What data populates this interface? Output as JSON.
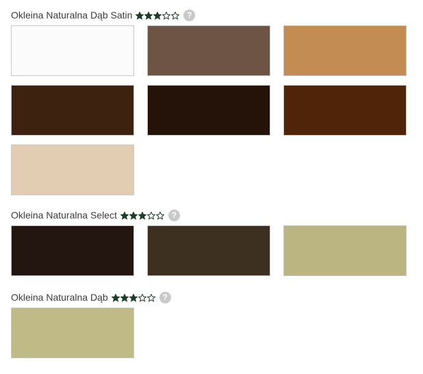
{
  "sections": [
    {
      "title": "Okleina Naturalna Dąb Satin",
      "rating": 3,
      "max_rating": 5,
      "help_label": "?",
      "swatches": [
        {
          "color": "#fbfbfb"
        },
        {
          "color": "#6d5444"
        },
        {
          "color": "#c38c52"
        },
        {
          "color": "#3d2210"
        },
        {
          "color": "#251209"
        },
        {
          "color": "#4f2409"
        },
        {
          "color": "#e3cdb2"
        }
      ]
    },
    {
      "title": "Okleina Naturalna Select",
      "rating": 3,
      "max_rating": 5,
      "help_label": "?",
      "swatches": [
        {
          "color": "#231611"
        },
        {
          "color": "#3e3021"
        },
        {
          "color": "#bbb681"
        }
      ]
    },
    {
      "title": "Okleina Naturalna Dąb",
      "rating": 3,
      "max_rating": 5,
      "help_label": "?",
      "swatches": [
        {
          "color": "#c0ba86"
        }
      ]
    }
  ],
  "colors": {
    "star_fill": "#1f3d2b",
    "star_empty": "#1f3d2b",
    "help_bg": "#c9c9c9"
  }
}
